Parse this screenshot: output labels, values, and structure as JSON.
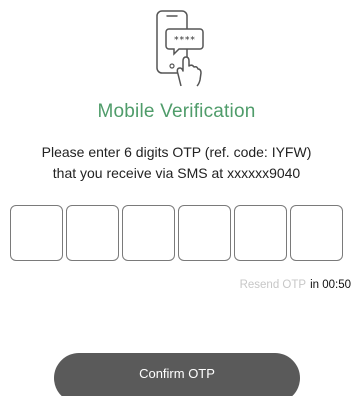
{
  "header": {
    "icon": "phone-sms-otp-icon",
    "icon_code": "****",
    "title": "Mobile Verification"
  },
  "instructions": {
    "line1": "Please enter 6 digits OTP (ref. code: IYFW)",
    "line2": "that you receive via SMS at xxxxxx9040"
  },
  "otp": {
    "boxes": [
      "",
      "",
      "",
      "",
      "",
      ""
    ]
  },
  "resend": {
    "label": "Resend OTP",
    "timer": "in 00:50"
  },
  "actions": {
    "confirm_label": "Confirm OTP"
  },
  "colors": {
    "accent": "#4f9c6a",
    "button": "#5a5a5a",
    "muted": "#c7c7c7"
  }
}
